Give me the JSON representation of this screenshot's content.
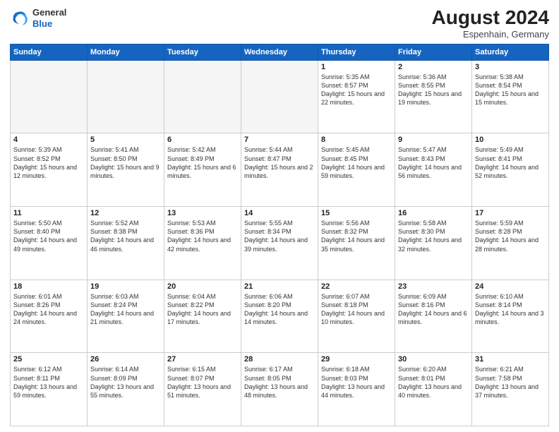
{
  "header": {
    "logo_line1": "General",
    "logo_line2": "Blue",
    "month_year": "August 2024",
    "location": "Espenhain, Germany"
  },
  "weekdays": [
    "Sunday",
    "Monday",
    "Tuesday",
    "Wednesday",
    "Thursday",
    "Friday",
    "Saturday"
  ],
  "weeks": [
    [
      {
        "day": "",
        "empty": true
      },
      {
        "day": "",
        "empty": true
      },
      {
        "day": "",
        "empty": true
      },
      {
        "day": "",
        "empty": true
      },
      {
        "day": "1",
        "sunrise": "5:35 AM",
        "sunset": "8:57 PM",
        "daylight": "15 hours and 22 minutes."
      },
      {
        "day": "2",
        "sunrise": "5:36 AM",
        "sunset": "8:55 PM",
        "daylight": "15 hours and 19 minutes."
      },
      {
        "day": "3",
        "sunrise": "5:38 AM",
        "sunset": "8:54 PM",
        "daylight": "15 hours and 15 minutes."
      }
    ],
    [
      {
        "day": "4",
        "sunrise": "5:39 AM",
        "sunset": "8:52 PM",
        "daylight": "15 hours and 12 minutes."
      },
      {
        "day": "5",
        "sunrise": "5:41 AM",
        "sunset": "8:50 PM",
        "daylight": "15 hours and 9 minutes."
      },
      {
        "day": "6",
        "sunrise": "5:42 AM",
        "sunset": "8:49 PM",
        "daylight": "15 hours and 6 minutes."
      },
      {
        "day": "7",
        "sunrise": "5:44 AM",
        "sunset": "8:47 PM",
        "daylight": "15 hours and 2 minutes."
      },
      {
        "day": "8",
        "sunrise": "5:45 AM",
        "sunset": "8:45 PM",
        "daylight": "14 hours and 59 minutes."
      },
      {
        "day": "9",
        "sunrise": "5:47 AM",
        "sunset": "8:43 PM",
        "daylight": "14 hours and 56 minutes."
      },
      {
        "day": "10",
        "sunrise": "5:49 AM",
        "sunset": "8:41 PM",
        "daylight": "14 hours and 52 minutes."
      }
    ],
    [
      {
        "day": "11",
        "sunrise": "5:50 AM",
        "sunset": "8:40 PM",
        "daylight": "14 hours and 49 minutes."
      },
      {
        "day": "12",
        "sunrise": "5:52 AM",
        "sunset": "8:38 PM",
        "daylight": "14 hours and 46 minutes."
      },
      {
        "day": "13",
        "sunrise": "5:53 AM",
        "sunset": "8:36 PM",
        "daylight": "14 hours and 42 minutes."
      },
      {
        "day": "14",
        "sunrise": "5:55 AM",
        "sunset": "8:34 PM",
        "daylight": "14 hours and 39 minutes."
      },
      {
        "day": "15",
        "sunrise": "5:56 AM",
        "sunset": "8:32 PM",
        "daylight": "14 hours and 35 minutes."
      },
      {
        "day": "16",
        "sunrise": "5:58 AM",
        "sunset": "8:30 PM",
        "daylight": "14 hours and 32 minutes."
      },
      {
        "day": "17",
        "sunrise": "5:59 AM",
        "sunset": "8:28 PM",
        "daylight": "14 hours and 28 minutes."
      }
    ],
    [
      {
        "day": "18",
        "sunrise": "6:01 AM",
        "sunset": "8:26 PM",
        "daylight": "14 hours and 24 minutes."
      },
      {
        "day": "19",
        "sunrise": "6:03 AM",
        "sunset": "8:24 PM",
        "daylight": "14 hours and 21 minutes."
      },
      {
        "day": "20",
        "sunrise": "6:04 AM",
        "sunset": "8:22 PM",
        "daylight": "14 hours and 17 minutes."
      },
      {
        "day": "21",
        "sunrise": "6:06 AM",
        "sunset": "8:20 PM",
        "daylight": "14 hours and 14 minutes."
      },
      {
        "day": "22",
        "sunrise": "6:07 AM",
        "sunset": "8:18 PM",
        "daylight": "14 hours and 10 minutes."
      },
      {
        "day": "23",
        "sunrise": "6:09 AM",
        "sunset": "8:16 PM",
        "daylight": "14 hours and 6 minutes."
      },
      {
        "day": "24",
        "sunrise": "6:10 AM",
        "sunset": "8:14 PM",
        "daylight": "14 hours and 3 minutes."
      }
    ],
    [
      {
        "day": "25",
        "sunrise": "6:12 AM",
        "sunset": "8:11 PM",
        "daylight": "13 hours and 59 minutes."
      },
      {
        "day": "26",
        "sunrise": "6:14 AM",
        "sunset": "8:09 PM",
        "daylight": "13 hours and 55 minutes."
      },
      {
        "day": "27",
        "sunrise": "6:15 AM",
        "sunset": "8:07 PM",
        "daylight": "13 hours and 51 minutes."
      },
      {
        "day": "28",
        "sunrise": "6:17 AM",
        "sunset": "8:05 PM",
        "daylight": "13 hours and 48 minutes."
      },
      {
        "day": "29",
        "sunrise": "6:18 AM",
        "sunset": "8:03 PM",
        "daylight": "13 hours and 44 minutes."
      },
      {
        "day": "30",
        "sunrise": "6:20 AM",
        "sunset": "8:01 PM",
        "daylight": "13 hours and 40 minutes."
      },
      {
        "day": "31",
        "sunrise": "6:21 AM",
        "sunset": "7:58 PM",
        "daylight": "13 hours and 37 minutes."
      }
    ]
  ]
}
